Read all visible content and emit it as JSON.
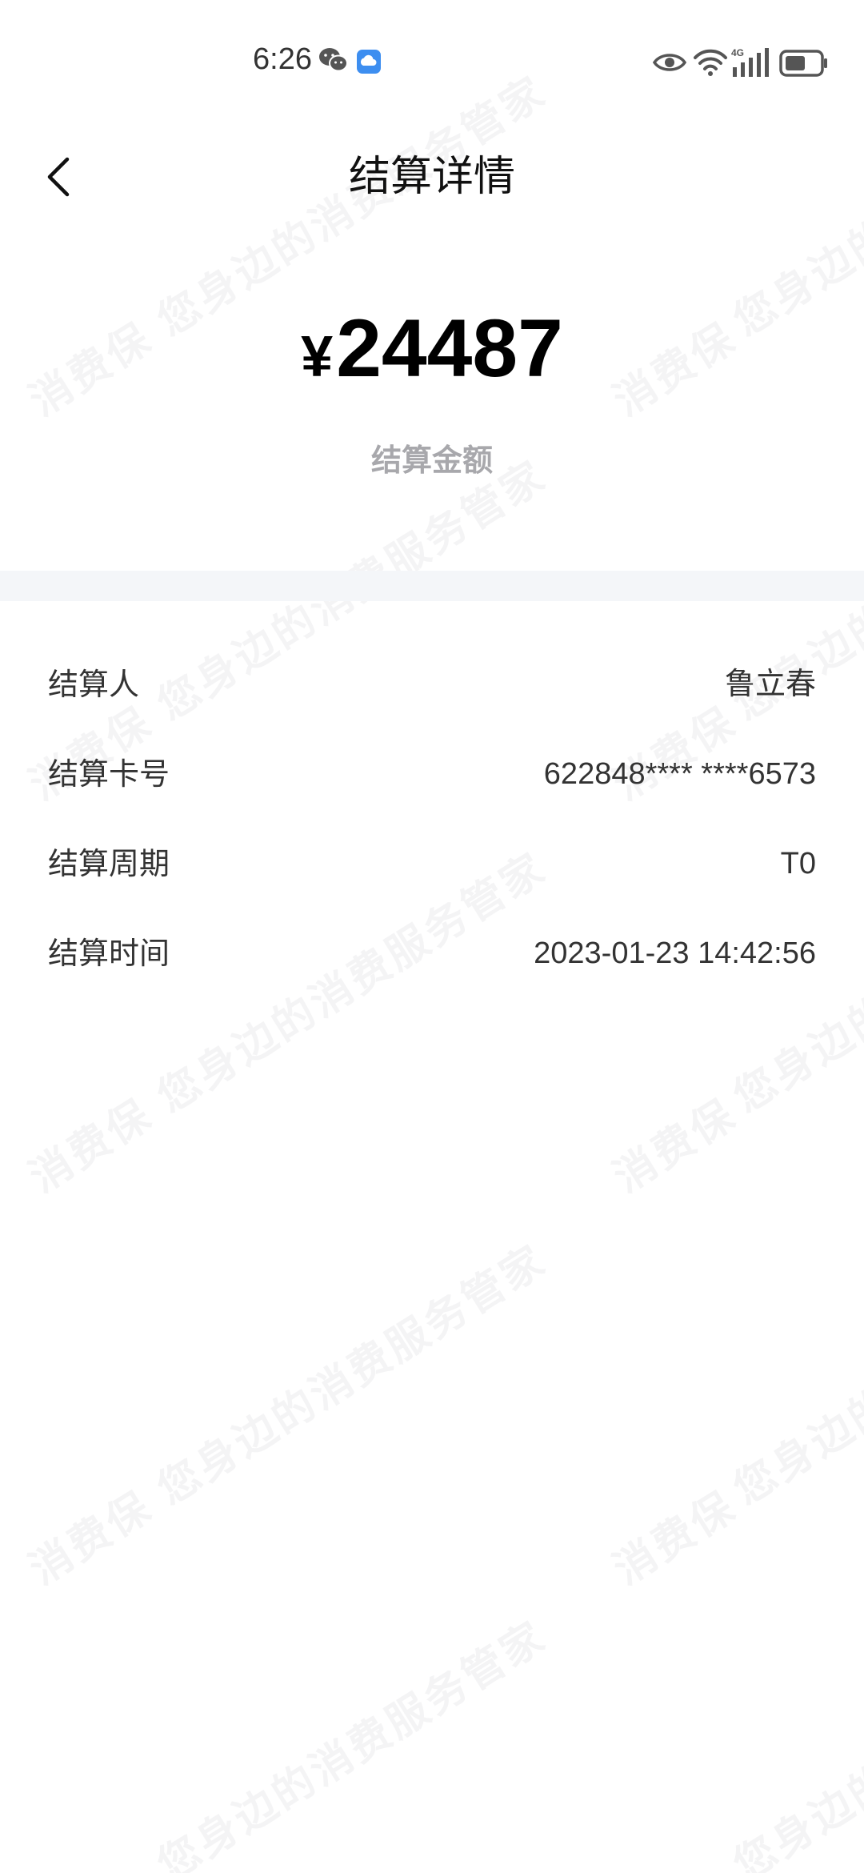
{
  "status_bar": {
    "time": "6:26",
    "icons": [
      "wechat-icon",
      "cloud-icon",
      "eye-icon",
      "wifi-icon",
      "signal-4g-icon",
      "battery-icon"
    ],
    "network_label": "4G"
  },
  "nav": {
    "title": "结算详情",
    "back_icon": "chevron-left-icon"
  },
  "amount": {
    "currency": "¥",
    "value": "24487",
    "label": "结算金额"
  },
  "details": [
    {
      "label": "结算人",
      "value": "鲁立春"
    },
    {
      "label": "结算卡号",
      "value": "622848**** ****6573"
    },
    {
      "label": "结算周期",
      "value": "T0"
    },
    {
      "label": "结算时间",
      "value": "2023-01-23 14:42:56"
    }
  ],
  "watermark": {
    "text_a": "消费保",
    "text_b": "您身边的消费服务管家"
  },
  "colors": {
    "background": "#ffffff",
    "divider": "#f4f6f9",
    "label_muted": "#a8a8ac",
    "text": "#333333"
  }
}
